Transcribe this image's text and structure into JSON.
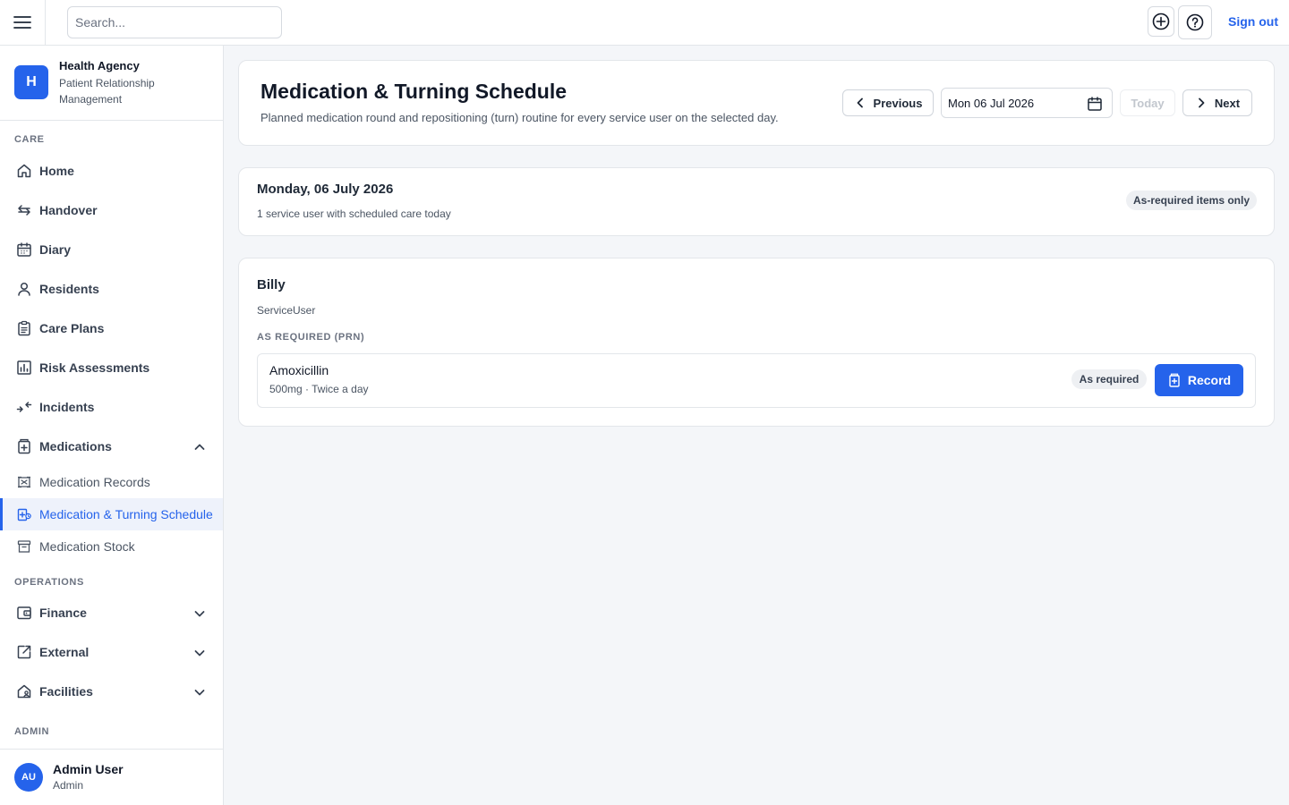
{
  "topbar": {
    "search_placeholder": "Search...",
    "signout_label": "Sign out"
  },
  "brand": {
    "initial": "H",
    "name": "Health Agency",
    "subtitle": "Patient Relationship Management"
  },
  "sidebar": {
    "care_label": "CARE",
    "operations_label": "OPERATIONS",
    "admin_label": "ADMIN",
    "care_items": [
      {
        "label": "Home",
        "icon": "home-icon"
      },
      {
        "label": "Handover",
        "icon": "arrows-exchange-icon"
      },
      {
        "label": "Diary",
        "icon": "calendar-icon"
      },
      {
        "label": "Residents",
        "icon": "person-icon"
      },
      {
        "label": "Care Plans",
        "icon": "clipboard-icon"
      },
      {
        "label": "Risk Assessments",
        "icon": "bar-chart-icon"
      },
      {
        "label": "Incidents",
        "icon": "arrows-in-icon"
      },
      {
        "label": "Medications",
        "icon": "medicine-box-icon"
      }
    ],
    "medication_subitems": [
      {
        "label": "Medication Records",
        "icon": "pill-record-icon"
      },
      {
        "label": "Medication & Turning Schedule",
        "icon": "schedule-icon"
      },
      {
        "label": "Medication Stock",
        "icon": "stock-box-icon"
      }
    ],
    "operations_items": [
      {
        "label": "Finance",
        "icon": "wallet-icon"
      },
      {
        "label": "External",
        "icon": "external-link-icon"
      },
      {
        "label": "Facilities",
        "icon": "house-person-icon"
      }
    ],
    "accent_color": "#2563eb"
  },
  "user": {
    "initials": "AU",
    "name": "Admin User",
    "role": "Admin"
  },
  "header": {
    "title": "Medication & Turning Schedule",
    "description": "Planned medication round and repositioning (turn) routine for every service user on the selected day.",
    "previous_label": "Previous",
    "date_value": "Mon 06 Jul 2026",
    "today_label": "Today",
    "next_label": "Next"
  },
  "day_summary": {
    "title": "Monday, 06 July 2026",
    "subtitle": "1 service user with scheduled care today",
    "filter_label": "As-required items only"
  },
  "resident": {
    "name": "Billy",
    "type": "ServiceUser",
    "section_label": "AS REQUIRED (PRN)",
    "medication": {
      "name": "Amoxicillin",
      "dose": "500mg · Twice a day",
      "badge": "As required",
      "record_label": "Record"
    }
  }
}
